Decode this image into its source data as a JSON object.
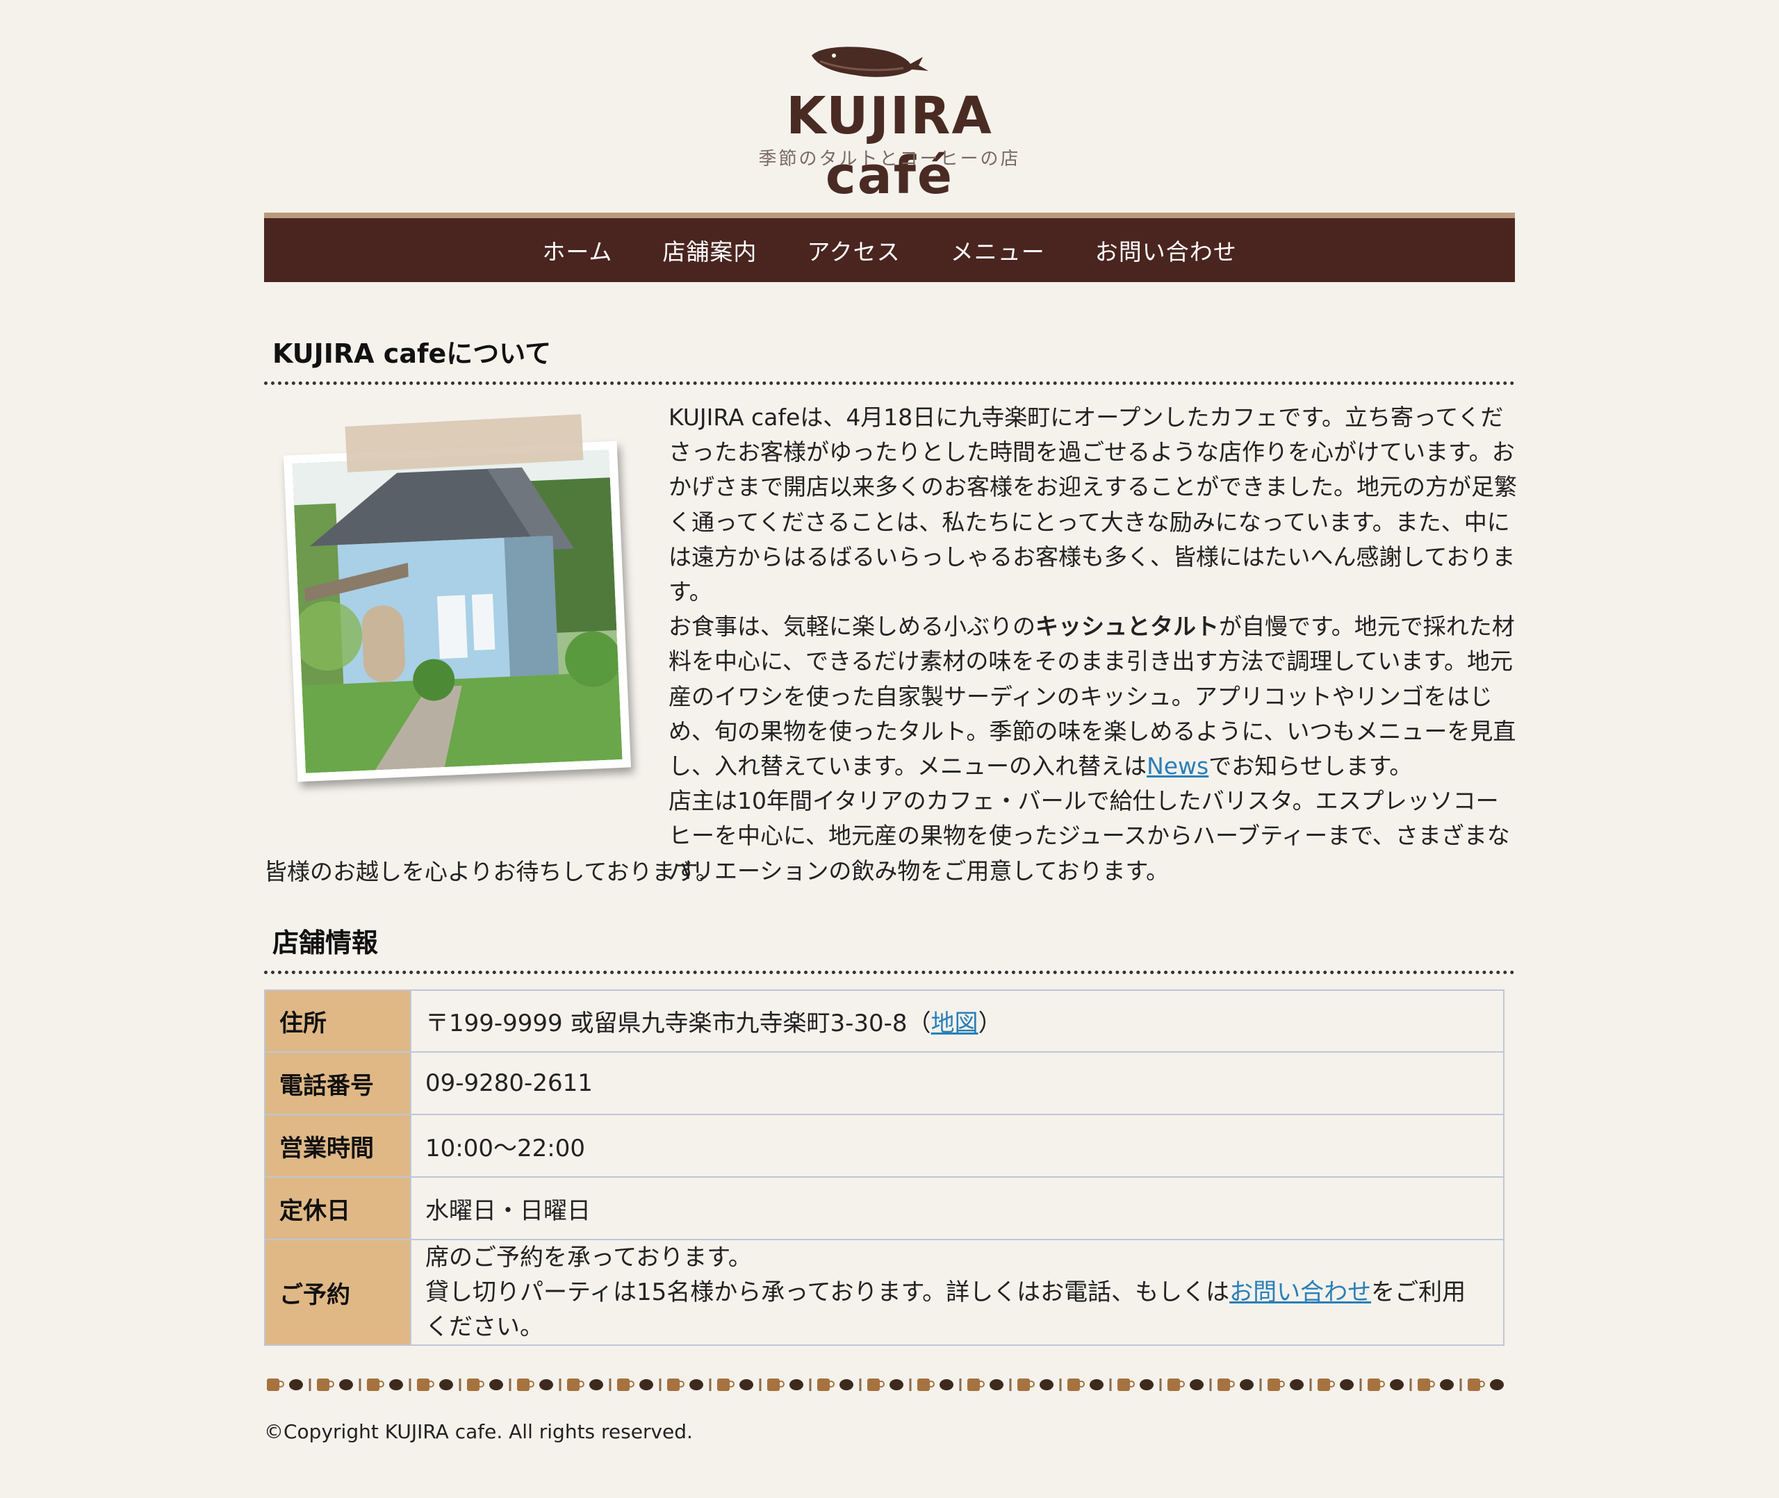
{
  "header": {
    "brand": "KUJIRA café",
    "tagline": "季節のタルトとコーヒーの店"
  },
  "nav": {
    "items": [
      "ホーム",
      "店舗案内",
      "アクセス",
      "メニュー",
      "お問い合わせ"
    ]
  },
  "about": {
    "title": "KUJIRA cafeについて",
    "p1": "KUJIRA cafeは、4月18日に九寺楽町にオープンしたカフェです。立ち寄ってくださったお客様がゆったりとした時間を過ごせるような店作りを心がけています。おかげさまで開店以来多くのお客様をお迎えすることができました。地元の方が足繁く通ってくださることは、私たちにとって大きな励みになっています。また、中には遠方からはるばるいらっしゃるお客様も多く、皆様にはたいへん感謝しております。",
    "p2_before": "お食事は、気軽に楽しめる小ぶりの",
    "p2_bold": "キッシュとタルト",
    "p2_after": "が自慢です。地元で採れた材料を中心に、できるだけ素材の味をそのまま引き出す方法で調理しています。地元産のイワシを使った自家製サーディンのキッシュ。アプリコットやリンゴをはじめ、旬の果物を使ったタルト。季節の味を楽しめるように、いつもメニューを見直し、入れ替えています。メニューの入れ替えは",
    "p2_link": "News",
    "p2_end": "でお知らせします。",
    "p3": "店主は10年間イタリアのカフェ・バールで給仕したバリスタ。エスプレッソコーヒーを中心に、地元産の果物を使ったジュースからハーブティーまで、さまざまなバリエーションの飲み物をご用意しております。",
    "closing": "皆様のお越しを心よりお待ちしております。"
  },
  "shop": {
    "title": "店舗情報",
    "address_label": "住所",
    "address_value": "〒199-9999 或留県九寺楽市九寺楽町3-30-8（",
    "address_link": "地図",
    "address_end": "）",
    "phone_label": "電話番号",
    "phone_value": "09-9280-2611",
    "hours_label": "営業時間",
    "hours_value": "10:00〜22:00",
    "closed_label": "定休日",
    "closed_value": "水曜日・日曜日",
    "reserve_label": "ご予約",
    "reserve_line1": "席のご予約を承っております。",
    "reserve_line2_before": "貸し切りパーティは15名様から承っております。詳しくはお電話、もしくは",
    "reserve_link": "お問い合わせ",
    "reserve_line2_after": "をご利用ください。"
  },
  "footer": {
    "copyright": "©Copyright KUJIRA cafe. All rights reserved."
  },
  "colors": {
    "background": "#f5f2ec",
    "nav": "#4a2520",
    "table_header": "#dfb886",
    "link": "#2a7fb8",
    "brand": "#4a2b24"
  },
  "icons": [
    "whale-logo-icon",
    "coffee-cup-icon",
    "coffee-bean-icon",
    "spoon-icon"
  ]
}
